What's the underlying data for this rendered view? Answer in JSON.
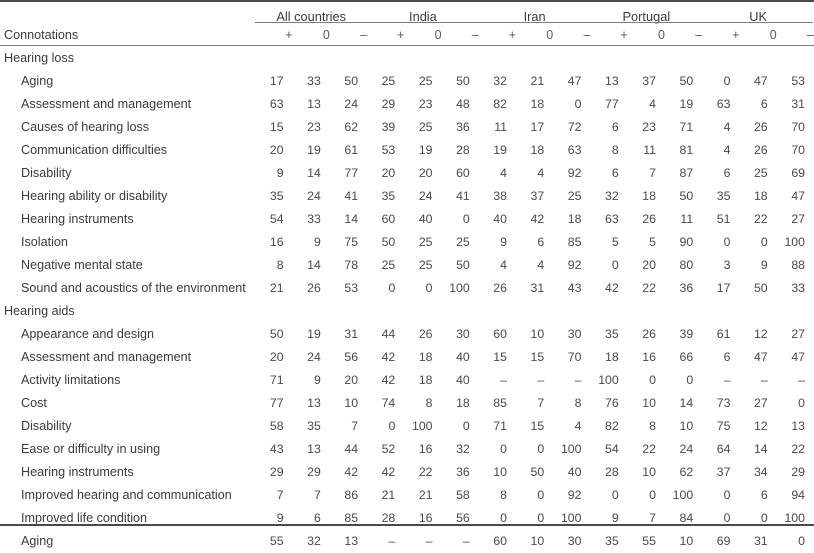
{
  "table": {
    "label_column_header": "",
    "country_groups": [
      {
        "name": "All countries"
      },
      {
        "name": "India"
      },
      {
        "name": "Iran"
      },
      {
        "name": "Portugal"
      },
      {
        "name": "UK"
      }
    ],
    "connotation_row_label": "Connotations",
    "connotation_signs": [
      "+",
      "0",
      "–",
      "+",
      "0",
      "–",
      "+",
      "0",
      "–",
      "+",
      "0",
      "–",
      "+",
      "0",
      "–"
    ],
    "sections": [
      {
        "title": "Hearing loss",
        "rows": [
          {
            "label": "Aging",
            "values": [
              "17",
              "33",
              "50",
              "25",
              "25",
              "50",
              "32",
              "21",
              "47",
              "13",
              "37",
              "50",
              "0",
              "47",
              "53"
            ]
          },
          {
            "label": "Assessment and management",
            "values": [
              "63",
              "13",
              "24",
              "29",
              "23",
              "48",
              "82",
              "18",
              "0",
              "77",
              "4",
              "19",
              "63",
              "6",
              "31"
            ]
          },
          {
            "label": "Causes of hearing loss",
            "values": [
              "15",
              "23",
              "62",
              "39",
              "25",
              "36",
              "11",
              "17",
              "72",
              "6",
              "23",
              "71",
              "4",
              "26",
              "70"
            ]
          },
          {
            "label": "Communication difficulties",
            "values": [
              "20",
              "19",
              "61",
              "53",
              "19",
              "28",
              "19",
              "18",
              "63",
              "8",
              "11",
              "81",
              "4",
              "26",
              "70"
            ]
          },
          {
            "label": "Disability",
            "values": [
              "9",
              "14",
              "77",
              "20",
              "20",
              "60",
              "4",
              "4",
              "92",
              "6",
              "7",
              "87",
              "6",
              "25",
              "69"
            ]
          },
          {
            "label": "Hearing ability or disability",
            "values": [
              "35",
              "24",
              "41",
              "35",
              "24",
              "41",
              "38",
              "37",
              "25",
              "32",
              "18",
              "50",
              "35",
              "18",
              "47"
            ]
          },
          {
            "label": "Hearing instruments",
            "values": [
              "54",
              "33",
              "14",
              "60",
              "40",
              "0",
              "40",
              "42",
              "18",
              "63",
              "26",
              "11",
              "51",
              "22",
              "27"
            ]
          },
          {
            "label": "Isolation",
            "values": [
              "16",
              "9",
              "75",
              "50",
              "25",
              "25",
              "9",
              "6",
              "85",
              "5",
              "5",
              "90",
              "0",
              "0",
              "100"
            ]
          },
          {
            "label": "Negative mental state",
            "values": [
              "8",
              "14",
              "78",
              "25",
              "25",
              "50",
              "4",
              "4",
              "92",
              "0",
              "20",
              "80",
              "3",
              "9",
              "88"
            ]
          },
          {
            "label": "Sound and acoustics of the environment",
            "values": [
              "21",
              "26",
              "53",
              "0",
              "0",
              "100",
              "26",
              "31",
              "43",
              "42",
              "22",
              "36",
              "17",
              "50",
              "33"
            ]
          }
        ]
      },
      {
        "title": "Hearing aids",
        "rows": [
          {
            "label": "Appearance and design",
            "values": [
              "50",
              "19",
              "31",
              "44",
              "26",
              "30",
              "60",
              "10",
              "30",
              "35",
              "26",
              "39",
              "61",
              "12",
              "27"
            ]
          },
          {
            "label": "Assessment and management",
            "values": [
              "20",
              "24",
              "56",
              "42",
              "18",
              "40",
              "15",
              "15",
              "70",
              "18",
              "16",
              "66",
              "6",
              "47",
              "47"
            ]
          },
          {
            "label": "Activity limitations",
            "values": [
              "71",
              "9",
              "20",
              "42",
              "18",
              "40",
              "–",
              "–",
              "–",
              "100",
              "0",
              "0",
              "–",
              "–",
              "–"
            ]
          },
          {
            "label": "Cost",
            "values": [
              "77",
              "13",
              "10",
              "74",
              "8",
              "18",
              "85",
              "7",
              "8",
              "76",
              "10",
              "14",
              "73",
              "27",
              "0"
            ]
          },
          {
            "label": "Disability",
            "values": [
              "58",
              "35",
              "7",
              "0",
              "100",
              "0",
              "71",
              "15",
              "4",
              "82",
              "8",
              "10",
              "75",
              "12",
              "13"
            ]
          },
          {
            "label": "Ease or difficulty in using",
            "values": [
              "43",
              "13",
              "44",
              "52",
              "16",
              "32",
              "0",
              "0",
              "100",
              "54",
              "22",
              "24",
              "64",
              "14",
              "22"
            ]
          },
          {
            "label": "Hearing instruments",
            "values": [
              "29",
              "29",
              "42",
              "42",
              "22",
              "36",
              "10",
              "50",
              "40",
              "28",
              "10",
              "62",
              "37",
              "34",
              "29"
            ]
          },
          {
            "label": "Improved hearing and communication",
            "values": [
              "7",
              "7",
              "86",
              "21",
              "21",
              "58",
              "8",
              "0",
              "92",
              "0",
              "0",
              "100",
              "0",
              "6",
              "94"
            ]
          },
          {
            "label": "Improved life condition",
            "values": [
              "9",
              "6",
              "85",
              "28",
              "16",
              "56",
              "0",
              "0",
              "100",
              "9",
              "7",
              "84",
              "0",
              "0",
              "100"
            ]
          },
          {
            "label": "Aging",
            "values": [
              "55",
              "32",
              "13",
              "–",
              "–",
              "–",
              "60",
              "10",
              "30",
              "35",
              "55",
              "10",
              "69",
              "31",
              "0"
            ]
          }
        ]
      }
    ]
  },
  "colors": {
    "rule_dark": "#4a4a4a",
    "rule_light": "#7d7d7d",
    "text": "#3b3b3b",
    "background": "#ffffff"
  }
}
